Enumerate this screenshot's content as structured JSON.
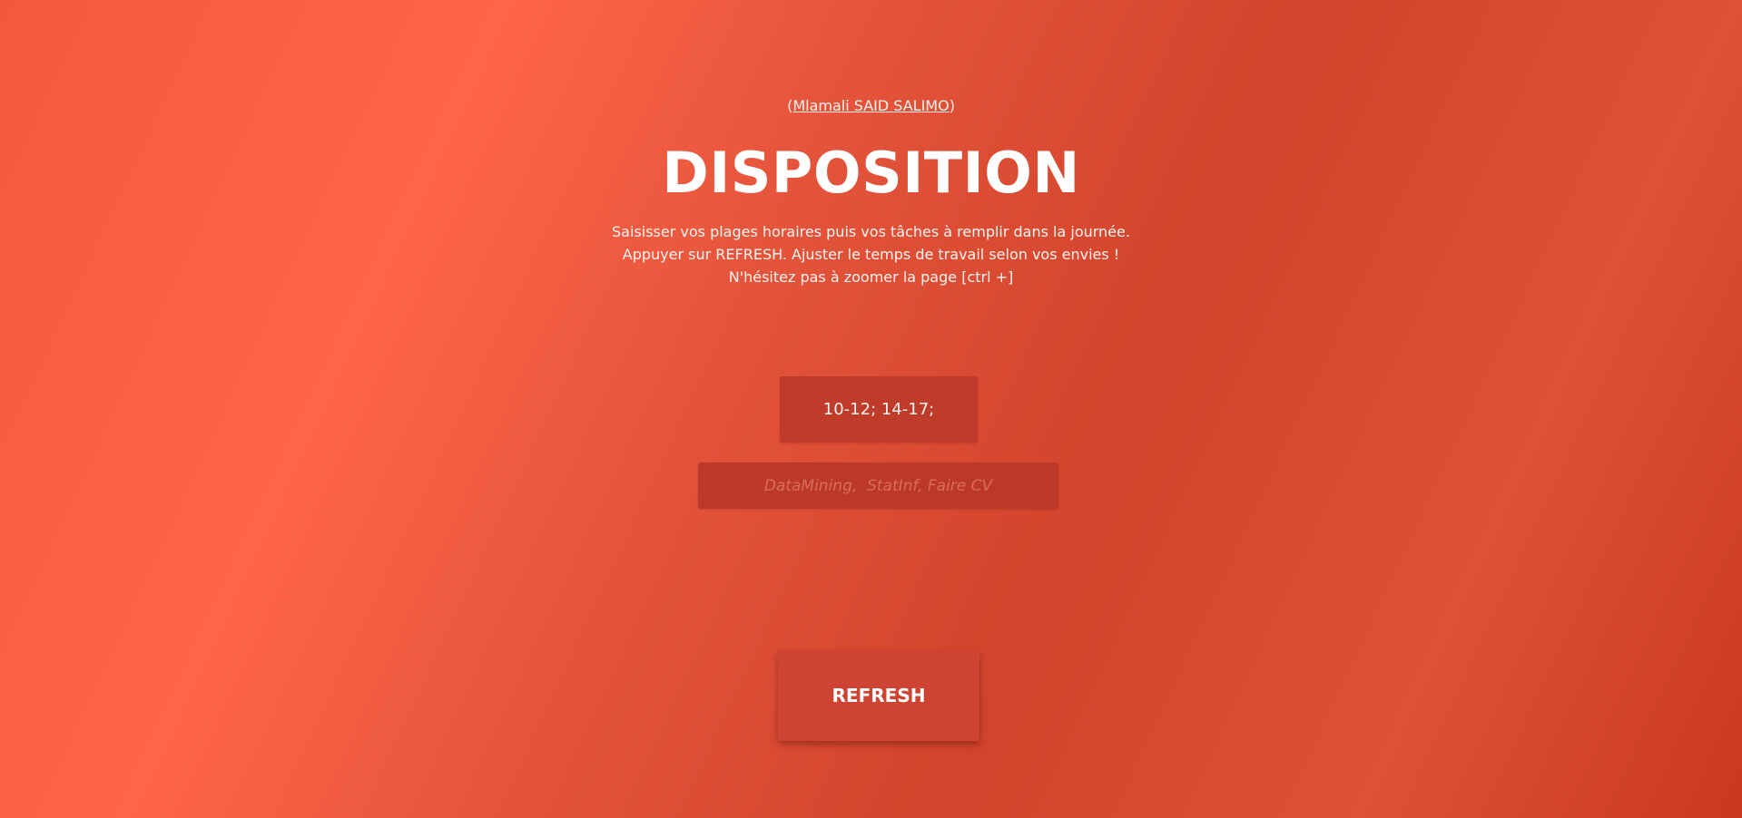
{
  "header": {
    "author_prefix": "(",
    "author_name": "Mlamali SAID SALIMO",
    "author_suffix": ")",
    "title": "DISPOSITION",
    "instructions": [
      "Saisisser vos plages horaires puis vos tâches à remplir dans la journée.",
      "Appuyer sur REFRESH. Ajuster le temps de travail selon vos envies !",
      "N'hésitez pas à zoomer la page [ctrl +]"
    ]
  },
  "form": {
    "slots_value": "10-12; 14-17;",
    "tasks_value": "",
    "tasks_placeholder": "DataMining,  StatInf, Faire CV",
    "refresh_label": "REFRESH"
  }
}
